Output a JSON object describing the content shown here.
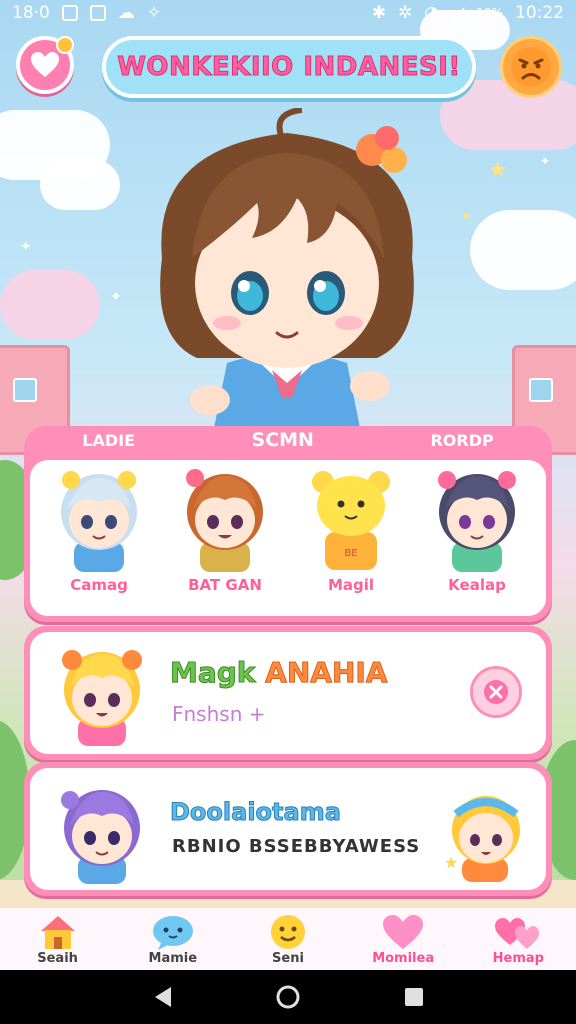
{
  "status_bar": {
    "time": "10:22",
    "left_text": "18·0",
    "battery": "19%"
  },
  "header": {
    "title": "WONKEKIIO INDANESI!",
    "icons": [
      "heart-icon",
      "angry-face-icon"
    ],
    "colors": {
      "title_pill": "#9fe2f7",
      "title_text": "#ff5fa2"
    }
  },
  "friends_card": {
    "tabs": [
      {
        "label": "LADIE",
        "active": false
      },
      {
        "label": "SCMN",
        "active": true
      },
      {
        "label": "RORDP",
        "active": false
      }
    ],
    "friends": [
      {
        "name": "Camag",
        "char": "blue-hair-boy"
      },
      {
        "name": "BAT GAN",
        "char": "orange-hair-boy"
      },
      {
        "name": "Magil",
        "char": "yellow-bear"
      },
      {
        "name": "Kealap",
        "char": "purple-hair-girl"
      }
    ]
  },
  "feature_card": {
    "title_a": "Magk",
    "title_b": "ANAHIA",
    "subtitle": "Fnshsn +",
    "colors": {
      "title_a": "#6cc24a",
      "title_b": "#ff8a3d",
      "subtitle": "#c77dd6"
    }
  },
  "info_card": {
    "title": "Doolaiotama",
    "subtitle": "RBNIO BSSEBBYAWESS"
  },
  "bottom_nav": {
    "items": [
      {
        "label": "Seaih",
        "icon": "house-icon",
        "pink": false
      },
      {
        "label": "Mamie",
        "icon": "chat-bubble-icon",
        "pink": false
      },
      {
        "label": "Seni",
        "icon": "smiley-icon",
        "pink": false
      },
      {
        "label": "Momilea",
        "icon": "heart-icon",
        "pink": true
      },
      {
        "label": "Hemap",
        "icon": "double-heart-icon",
        "pink": true
      }
    ]
  },
  "system_nav": [
    "back-icon",
    "home-icon",
    "recents-icon"
  ]
}
